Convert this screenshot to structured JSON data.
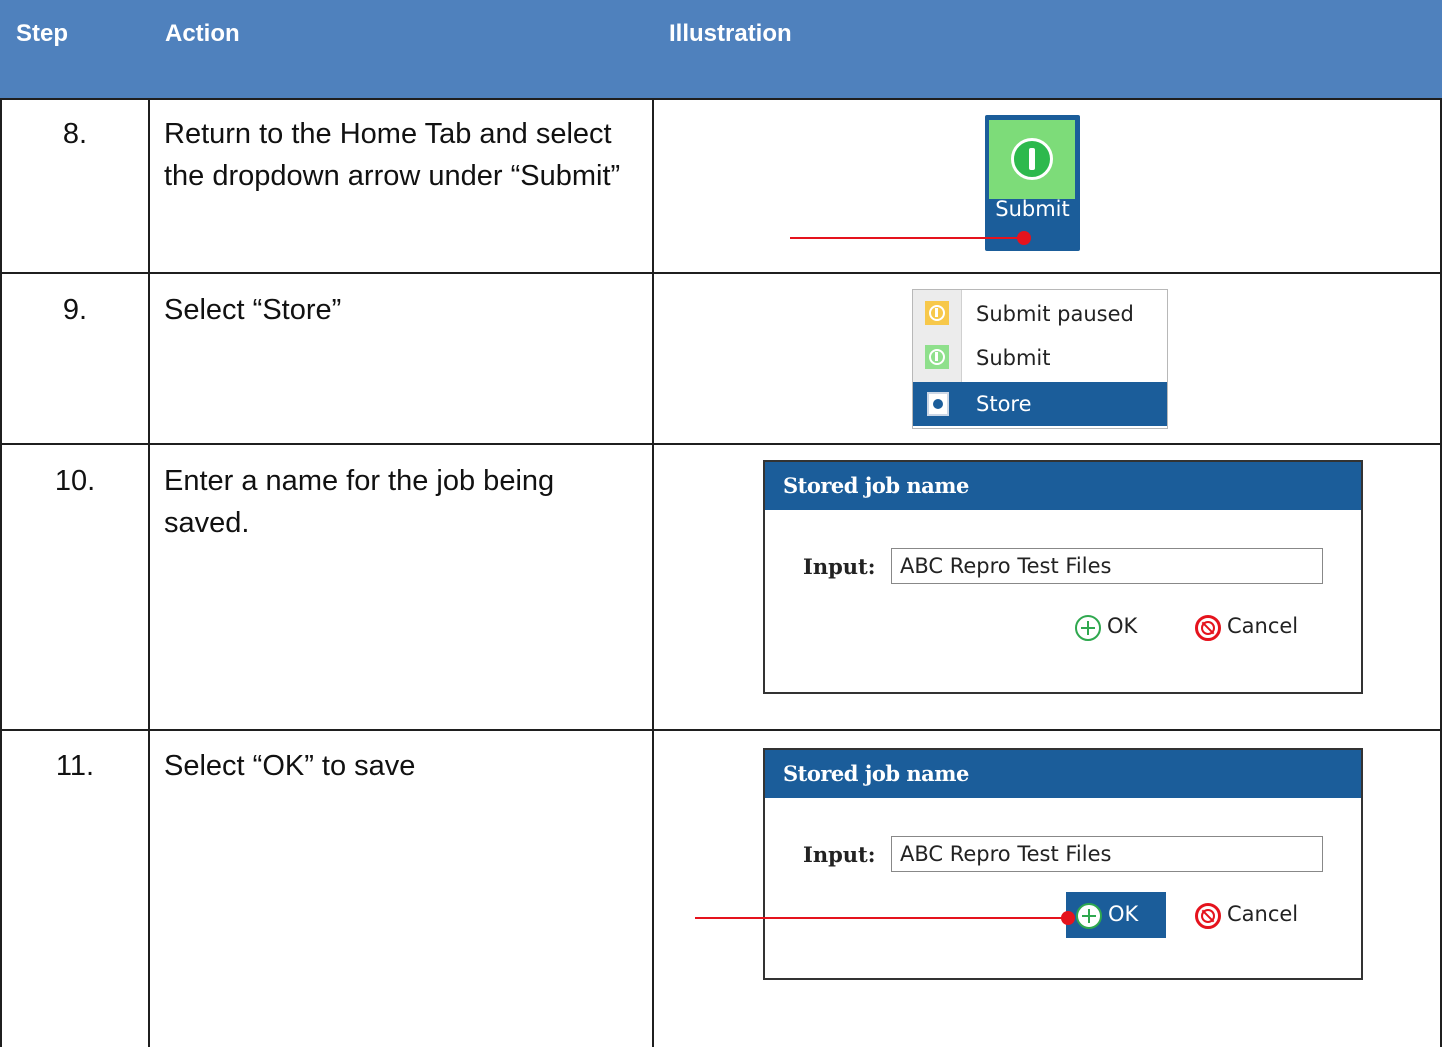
{
  "header": {
    "col_step": "Step",
    "col_action": "Action",
    "col_illustration": "Illustration"
  },
  "rows": [
    {
      "step": "8.",
      "action": "Return to the Home Tab and select the dropdown arrow under “Submit”"
    },
    {
      "step": "9.",
      "action": "Select “Store”"
    },
    {
      "step": "10.",
      "action": "Enter a name for the job being saved."
    },
    {
      "step": "11.",
      "action": "Select “OK” to save"
    }
  ],
  "submit_button": {
    "label": "Submit",
    "icon": "power-icon"
  },
  "menu": {
    "items": [
      {
        "label": "Submit paused",
        "icon": "power-icon-yellow"
      },
      {
        "label": "Submit",
        "icon": "power-icon-green"
      },
      {
        "label": "Store",
        "icon": "store-icon",
        "selected": true
      }
    ]
  },
  "dialog": {
    "title": "Stored job name",
    "input_label": "Input:",
    "input_value": "ABC Repro Test Files",
    "ok_label": "OK",
    "cancel_label": "Cancel"
  },
  "colors": {
    "header_bg": "#4f81bd",
    "dialog_title_bg": "#1b5d9a",
    "pointer": "#e5131d"
  }
}
